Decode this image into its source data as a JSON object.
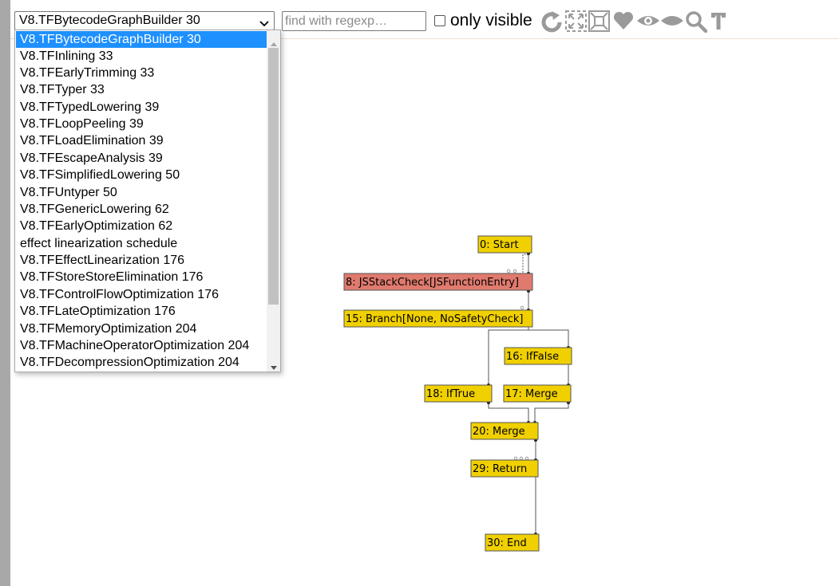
{
  "toolbar": {
    "selected_phase": "V8.TFBytecodeGraphBuilder 30",
    "search_placeholder": "find with regexp…",
    "only_visible_label": "only visible",
    "icons": [
      "relayout-icon",
      "show-all-icon",
      "show-selected-icon",
      "toggle-hide-dead-icon",
      "hide-unselected-icon",
      "hide-selected-icon",
      "zoom-selection-icon",
      "toggle-types-icon"
    ]
  },
  "dropdown": {
    "options": [
      "V8.TFBytecodeGraphBuilder 30",
      "V8.TFInlining 33",
      "V8.TFEarlyTrimming 33",
      "V8.TFTyper 33",
      "V8.TFTypedLowering 39",
      "V8.TFLoopPeeling 39",
      "V8.TFLoadElimination 39",
      "V8.TFEscapeAnalysis 39",
      "V8.TFSimplifiedLowering 50",
      "V8.TFUntyper 50",
      "V8.TFGenericLowering 62",
      "V8.TFEarlyOptimization 62",
      "effect linearization schedule",
      "V8.TFEffectLinearization 176",
      "V8.TFStoreStoreElimination 176",
      "V8.TFControlFlowOptimization 176",
      "V8.TFLateOptimization 176",
      "V8.TFMemoryOptimization 204",
      "V8.TFMachineOperatorOptimization 204",
      "V8.TFDecompressionOptimization 204"
    ],
    "selected_index": 0
  },
  "graph": {
    "nodes": [
      {
        "id": "0",
        "label": "0: Start",
        "color": "#f0d000"
      },
      {
        "id": "8",
        "label": "8: JSStackCheck[JSFunctionEntry]",
        "color": "#e07a6e"
      },
      {
        "id": "15",
        "label": "15: Branch[None, NoSafetyCheck]",
        "color": "#f0d000"
      },
      {
        "id": "16",
        "label": "16: IfFalse",
        "color": "#f0d000"
      },
      {
        "id": "18",
        "label": "18: IfTrue",
        "color": "#f0d000"
      },
      {
        "id": "17",
        "label": "17: Merge",
        "color": "#f0d000"
      },
      {
        "id": "20",
        "label": "20: Merge",
        "color": "#f0d000"
      },
      {
        "id": "29",
        "label": "29: Return",
        "color": "#f0d000"
      },
      {
        "id": "30",
        "label": "30: End",
        "color": "#f0d000"
      }
    ]
  },
  "colors": {
    "control_node": "#f0d000",
    "selected_node": "#e07a6e",
    "selected_option": "#1e90ff"
  }
}
